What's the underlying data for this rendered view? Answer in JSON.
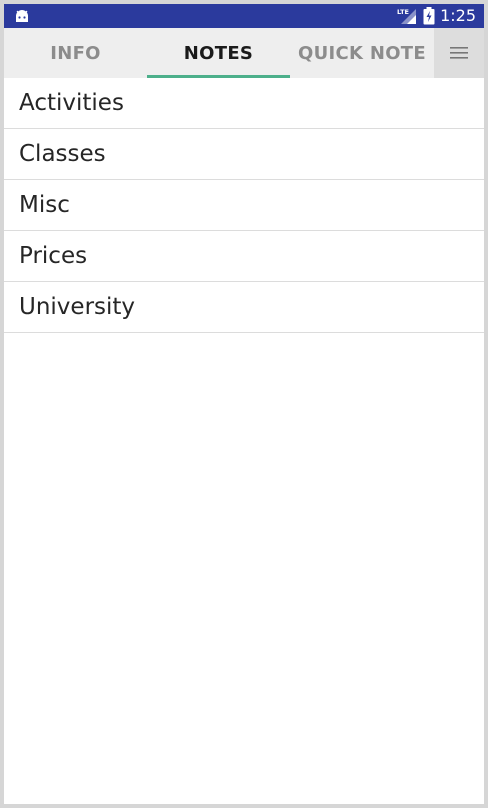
{
  "status_bar": {
    "time": "1:25",
    "network": "LTE",
    "background_color": "#2b3a9d",
    "icons": [
      "android-icon",
      "lte-signal-icon",
      "battery-charging-icon"
    ]
  },
  "tabs": [
    {
      "label": "INFO",
      "active": false
    },
    {
      "label": "NOTES",
      "active": true
    },
    {
      "label": "QUICK NOTE",
      "active": false
    }
  ],
  "tab_indicator_color": "#4caf8a",
  "menu_icon": "hamburger-menu-icon",
  "notes": [
    {
      "label": "Activities"
    },
    {
      "label": "Classes"
    },
    {
      "label": "Misc"
    },
    {
      "label": "Prices"
    },
    {
      "label": "University"
    }
  ]
}
